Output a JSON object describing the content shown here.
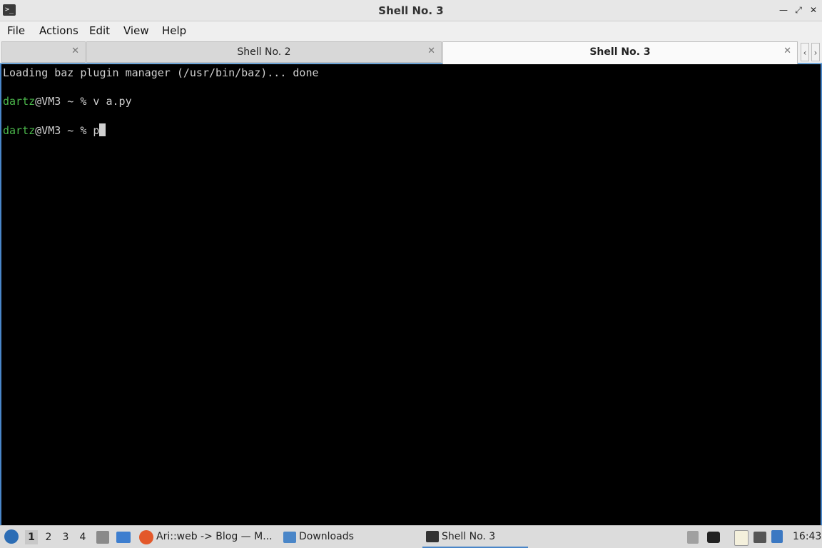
{
  "window": {
    "title": "Shell No. 3"
  },
  "menu": [
    "File",
    "Actions",
    "Edit",
    "View",
    "Help"
  ],
  "tabs": [
    {
      "label": ""
    },
    {
      "label": "Shell No. 2"
    },
    {
      "label": "Shell No. 3"
    }
  ],
  "terminal": {
    "line1": "Loading baz plugin manager (/usr/bin/baz)... done",
    "prompt1_user": "dartz",
    "prompt1_rest": "@VM3 ~ % v a.py",
    "prompt2_user": "dartz",
    "prompt2_rest": "@VM3 ~ % p"
  },
  "taskbar": {
    "desktops": [
      "1",
      "2",
      "3",
      "4"
    ],
    "tasks": [
      "Ari::web -> Blog — M...",
      "Downloads",
      "Shell No. 3"
    ],
    "clock": "16:43"
  },
  "colors": {
    "accent": "#4a86c8",
    "prompt_user": "#4cb84c"
  }
}
